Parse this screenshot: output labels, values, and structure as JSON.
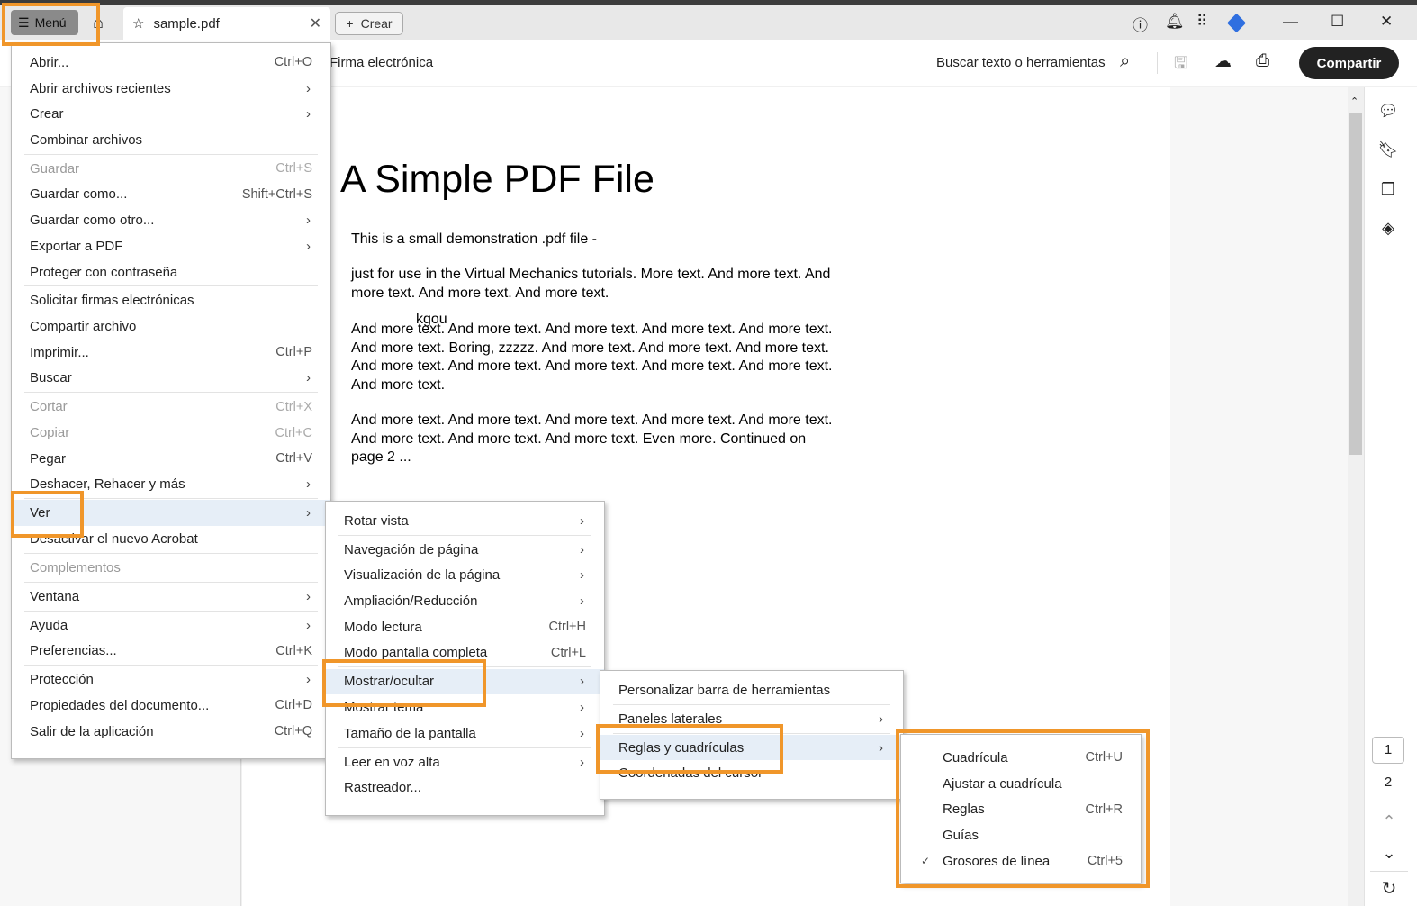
{
  "tabbar": {
    "menu_label": "Menú",
    "tab_title": "sample.pdf",
    "create_label": "Crear"
  },
  "toolbar": {
    "left_label": "Firma electrónica",
    "search_label": "Buscar texto o herramientas",
    "share_label": "Compartir"
  },
  "pdf": {
    "title": "A Simple PDF File",
    "paragraphs": [
      "This is a small demonstration .pdf file -",
      "just for use in the Virtual Mechanics tutorials. More text. And more text. And more text. And more text. And more text.",
      "And more text. And more text. And more text. And more text. And more text. And more text. Boring, zzzzz. And more text. And more text. And more text. And more text. And more text. And more text. And more text. And more text. And more text.",
      "And more text. And more text. And more text. And more text. And more text. And more text. And more text. And more text. Even more. Continued on page 2 ..."
    ],
    "overlay": "kgou"
  },
  "page_nav": {
    "pages": [
      "1",
      "2"
    ],
    "current": "1"
  },
  "main_menu": [
    {
      "label": "Abrir...",
      "shortcut": "Ctrl+O"
    },
    {
      "label": "Abrir archivos recientes",
      "sub": true
    },
    {
      "label": "Crear",
      "sub": true
    },
    {
      "label": "Combinar archivos",
      "sep": true
    },
    {
      "label": "Guardar",
      "shortcut": "Ctrl+S",
      "disabled": true
    },
    {
      "label": "Guardar como...",
      "shortcut": "Shift+Ctrl+S"
    },
    {
      "label": "Guardar como otro...",
      "sub": true
    },
    {
      "label": "Exportar a PDF",
      "sub": true
    },
    {
      "label": "Proteger con contraseña",
      "sep": true
    },
    {
      "label": "Solicitar firmas electrónicas"
    },
    {
      "label": "Compartir archivo"
    },
    {
      "label": "Imprimir...",
      "shortcut": "Ctrl+P"
    },
    {
      "label": "Buscar",
      "sub": true,
      "sep": true
    },
    {
      "label": "Cortar",
      "shortcut": "Ctrl+X",
      "disabled": true
    },
    {
      "label": "Copiar",
      "shortcut": "Ctrl+C",
      "disabled": true
    },
    {
      "label": "Pegar",
      "shortcut": "Ctrl+V"
    },
    {
      "label": "Deshacer, Rehacer y más",
      "sub": true,
      "sep": true
    },
    {
      "label": "Ver",
      "sub": true,
      "highlighted": true
    },
    {
      "label": "Desactivar el nuevo Acrobat",
      "sep": true
    },
    {
      "label": "Complementos",
      "disabled": true,
      "sep": true
    },
    {
      "label": "Ventana",
      "sub": true,
      "sep": true
    },
    {
      "label": "Ayuda",
      "sub": true
    },
    {
      "label": "Preferencias...",
      "shortcut": "Ctrl+K",
      "sep": true
    },
    {
      "label": "Protección",
      "sub": true
    },
    {
      "label": "Propiedades del documento...",
      "shortcut": "Ctrl+D"
    },
    {
      "label": "Salir de la aplicación",
      "shortcut": "Ctrl+Q"
    }
  ],
  "view_menu": [
    {
      "label": "Rotar vista",
      "sub": true,
      "sep": true
    },
    {
      "label": "Navegación de página",
      "sub": true
    },
    {
      "label": "Visualización de la página",
      "sub": true
    },
    {
      "label": "Ampliación/Reducción",
      "sub": true
    },
    {
      "label": "Modo lectura",
      "shortcut": "Ctrl+H"
    },
    {
      "label": "Modo pantalla completa",
      "shortcut": "Ctrl+L",
      "sep": true
    },
    {
      "label": "Mostrar/ocultar",
      "sub": true,
      "highlighted": true
    },
    {
      "label": "Mostrar tema",
      "sub": true
    },
    {
      "label": "Tamaño de la pantalla",
      "sub": true,
      "sep": true
    },
    {
      "label": "Leer en voz alta",
      "sub": true
    },
    {
      "label": "Rastreador..."
    }
  ],
  "showhide_menu": [
    {
      "label": "Personalizar barra de herramientas",
      "sep": true
    },
    {
      "label": "Paneles laterales",
      "sub": true,
      "sep": true
    },
    {
      "label": "Reglas y cuadrículas",
      "sub": true,
      "highlighted": true
    },
    {
      "label": "Coordenadas del cursor"
    }
  ],
  "rulers_menu": [
    {
      "label": "Cuadrícula",
      "shortcut": "Ctrl+U"
    },
    {
      "label": "Ajustar a cuadrícula"
    },
    {
      "label": "Reglas",
      "shortcut": "Ctrl+R"
    },
    {
      "label": "Guías"
    },
    {
      "label": "Grosores de línea",
      "shortcut": "Ctrl+5",
      "checked": true
    }
  ],
  "colors": {
    "highlight": "#f0962a"
  }
}
